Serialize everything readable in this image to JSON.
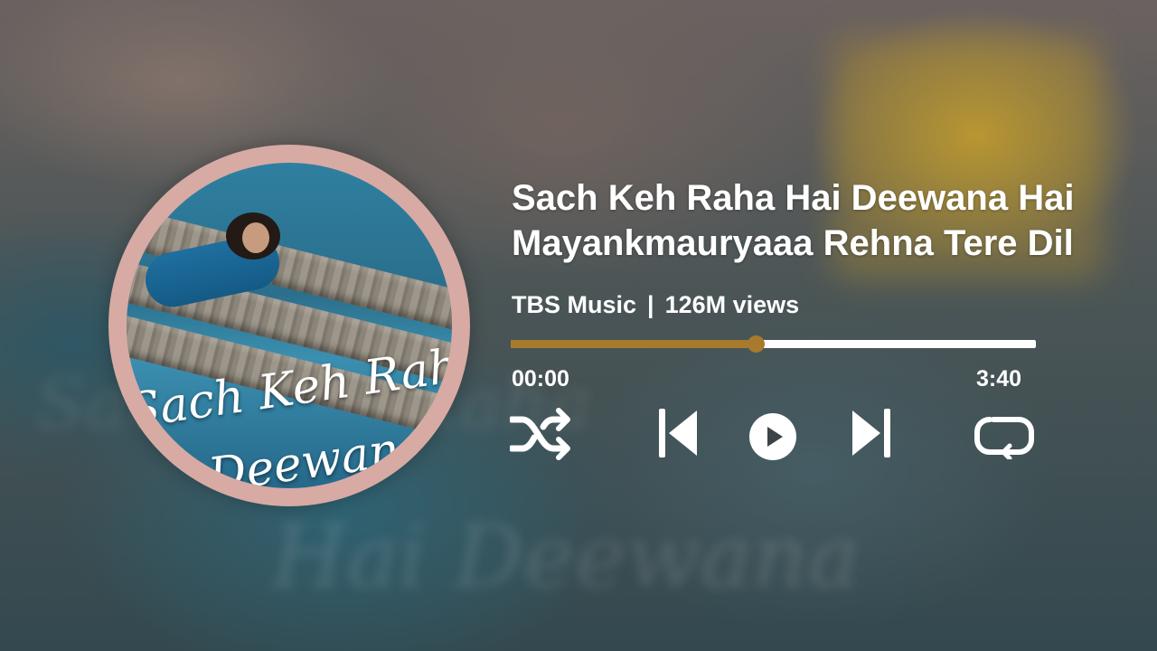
{
  "background": {
    "blur_text_1": "Hai Deewana",
    "blur_text_2": "Sach Keh Raha"
  },
  "album_art": {
    "script_line_1": "Sach Keh Raha",
    "script_line_2": "Deewana",
    "ring_color": "#d7aaa4"
  },
  "track": {
    "title_line_1": "Sach Keh Raha Hai Deewana Hai",
    "title_line_2": "Mayankmauryaaa Rehna Tere Dil",
    "channel": "TBS Music",
    "separator": "|",
    "views": "126M views"
  },
  "player": {
    "progress_fraction": 0.466,
    "accent_color": "#a77a2c",
    "current_time": "00:00",
    "duration": "3:40",
    "controls": [
      "shuffle-icon",
      "previous-icon",
      "play-icon",
      "next-icon",
      "repeat-icon"
    ]
  }
}
